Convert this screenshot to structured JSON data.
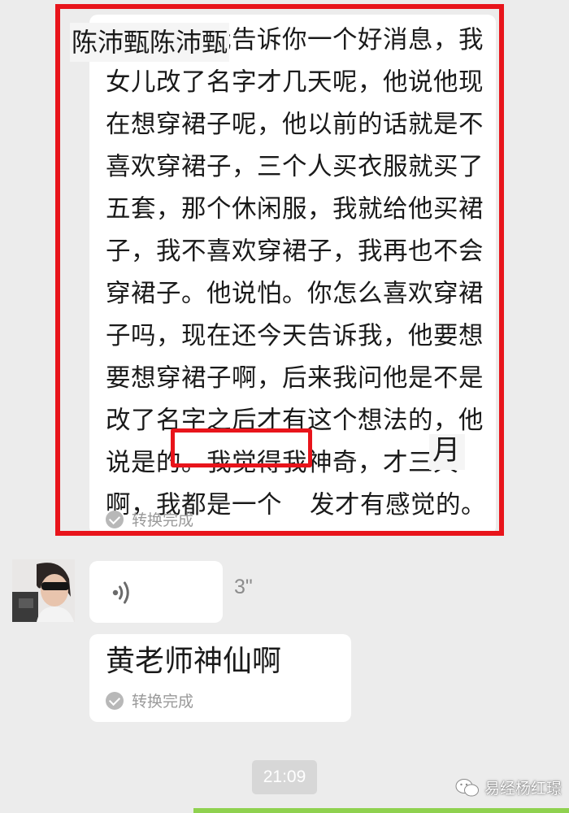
{
  "messages": {
    "transcript_1": {
      "sender_overlay": "陈沛甄陈沛甄",
      "text_part_1": "晚上好，我告诉你一个好消息，我女儿改了名字才几天呢，他说他现在想穿裙子呢，他以前的话就是不喜欢穿裙子，三个人买衣服就买了五套，那个休闲服，我就给他买裙子，我不喜欢穿裙子，我再也不会穿裙子。他说怕。你怎么喜欢穿裙子吗，现在还今天告诉我，他要想要想穿裙子啊，后来我问他是不是改了名字之后才有这个想法的，他说是的。我觉得我神奇，",
      "highlight": "才三天啊，",
      "text_part_2": "我都是一个",
      "month_overlay": "月",
      "text_part_3": "发才有感觉的。",
      "status": "转换完成"
    },
    "voice": {
      "duration": "3\""
    },
    "transcript_2": {
      "text": "黄老师神仙啊",
      "status": "转换完成"
    }
  },
  "timestamp": "21:09",
  "watermark": {
    "text": "易经杨红璟",
    "icon": "wechat-icon"
  },
  "colors": {
    "annotation_red": "#e8141b",
    "background": "#ececec",
    "bubble": "#ffffff"
  }
}
